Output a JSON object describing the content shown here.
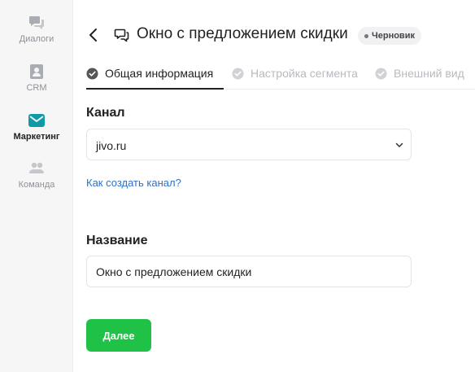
{
  "sidebar": {
    "items": [
      {
        "label": "Диалоги",
        "icon": "chat-bubbles-icon",
        "active": false
      },
      {
        "label": "CRM",
        "icon": "contact-card-icon",
        "active": false
      },
      {
        "label": "Маркетинг",
        "icon": "envelope-icon",
        "active": true
      },
      {
        "label": "Команда",
        "icon": "people-icon",
        "active": false
      }
    ]
  },
  "header": {
    "title": "Окно с предложением скидки",
    "status": "Черновик"
  },
  "tabs": [
    {
      "label": "Общая информация",
      "active": true
    },
    {
      "label": "Настройка сегмента",
      "active": false
    },
    {
      "label": "Внешний вид",
      "active": false
    }
  ],
  "form": {
    "channel_label": "Канал",
    "channel_value": "jivo.ru",
    "help_link": "Как создать канал?",
    "name_label": "Название",
    "name_value": "Окно с предложением скидки",
    "next_button": "Далее"
  },
  "colors": {
    "accent_teal": "#0f9aa6",
    "primary_green": "#1fc146",
    "link_blue": "#2d72c4",
    "inactive_gray": "#b7babe"
  }
}
